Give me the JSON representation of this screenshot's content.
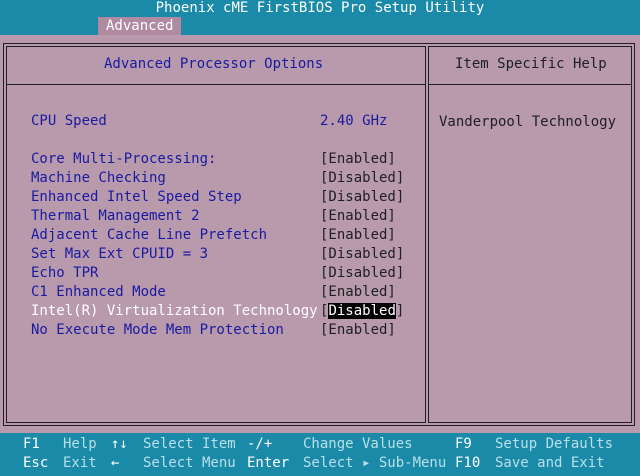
{
  "title": "Phoenix cME FirstBIOS Pro Setup Utility",
  "menu": {
    "active_tab": "Advanced"
  },
  "panel": {
    "title": "Advanced Processor Options",
    "help_title": "Item Specific Help",
    "help_text": "Vanderpool Technology"
  },
  "cpu_speed": {
    "label": "CPU Speed",
    "value": "2.40 GHz"
  },
  "options": [
    {
      "label": "Core Multi-Processing:",
      "value": "[Enabled]"
    },
    {
      "label": "Machine Checking",
      "value": "[Disabled]"
    },
    {
      "label": "Enhanced Intel Speed Step",
      "value": "[Disabled]"
    },
    {
      "label": "Thermal Management 2",
      "value": "[Enabled]"
    },
    {
      "label": "Adjacent Cache Line Prefetch",
      "value": "[Enabled]"
    },
    {
      "label": "Set Max Ext CPUID = 3",
      "value": "[Disabled]"
    },
    {
      "label": "Echo TPR",
      "value": "[Disabled]"
    },
    {
      "label": "C1 Enhanced Mode",
      "value": "[Enabled]"
    },
    {
      "label": "Intel(R) Virtualization Technology",
      "value_open": "[",
      "value_inner": "Disabled",
      "value_close": "]"
    },
    {
      "label": "No Execute Mode Mem Protection",
      "value": "[Enabled]"
    }
  ],
  "footer": {
    "row1": [
      {
        "key": "F1",
        "desc": "Help"
      },
      {
        "key": "↑↓",
        "desc": "Select Item"
      },
      {
        "key": "-/+",
        "desc": "Change Values"
      },
      {
        "key": "F9",
        "desc": "Setup Defaults"
      }
    ],
    "row2": [
      {
        "key": "Esc",
        "desc": "Exit"
      },
      {
        "key": "←",
        "desc": "Select Menu"
      },
      {
        "key": "Enter",
        "desc": "Select ▸ Sub-Menu"
      },
      {
        "key": "F10",
        "desc": "Save and Exit"
      }
    ]
  },
  "colors": {
    "background": "#1a8aa8",
    "panel": "#b89aac",
    "label_text": "#1a1aa0",
    "value_text": "#202020",
    "highlight": "#000000"
  }
}
